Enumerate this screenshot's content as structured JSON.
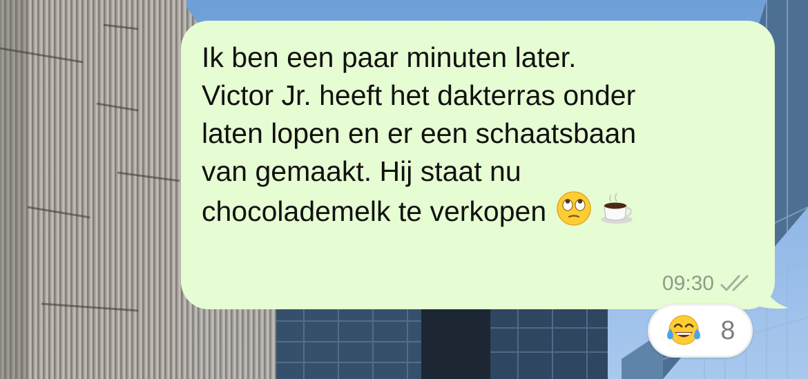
{
  "message": {
    "text": "Ik ben een paar minuten later.\nVictor Jr. heeft het dakterras onder\nlaten lopen en er een schaatsbaan\nvan gemaakt. Hij staat nu\nchocolademelk te verkopen",
    "emojis": [
      "face-with-rolling-eyes-icon",
      "hot-beverage-icon"
    ],
    "time": "09:30",
    "status_icon": "double-check-icon",
    "bubble_color": "#e6fcd2"
  },
  "reaction": {
    "emoji": "face-with-tears-of-joy-icon",
    "count": "8"
  },
  "background": {
    "description_colors": {
      "sky": "#7aa8dc",
      "cladding": "#a7a39c",
      "glass": "#3f5d7d"
    }
  }
}
